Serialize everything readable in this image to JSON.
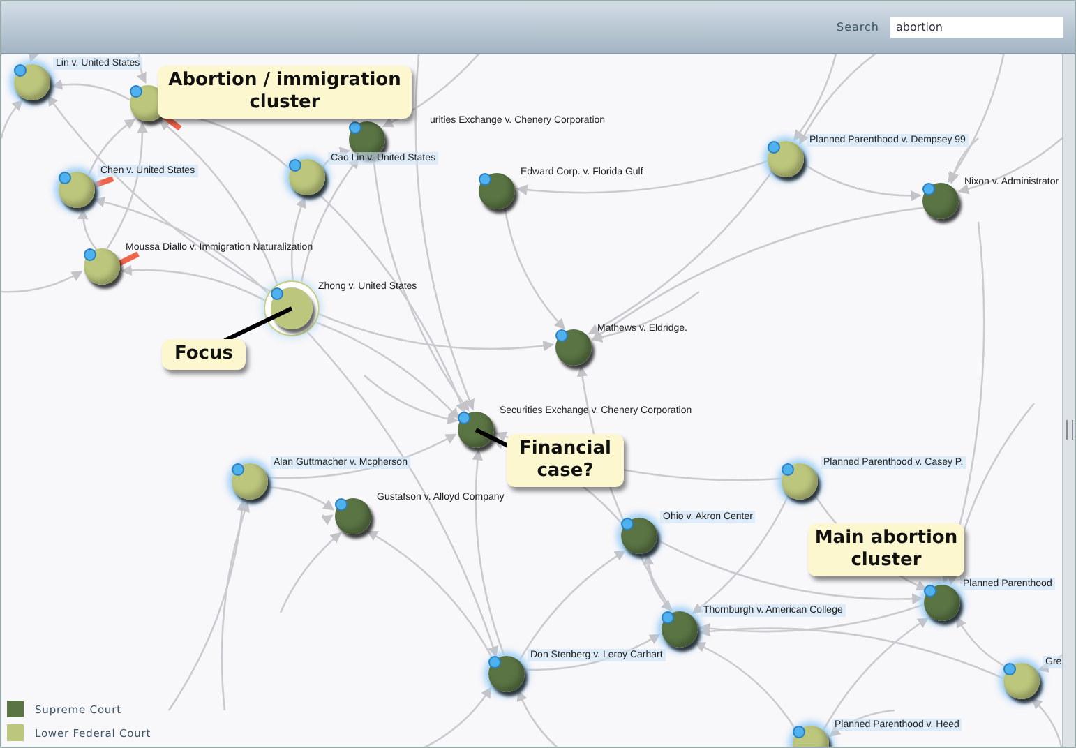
{
  "search": {
    "label": "Search",
    "value": "abortion"
  },
  "nodes": [
    {
      "label": "Lin v. United States",
      "kind": "lower",
      "highlighted": true,
      "selected": false
    },
    {
      "kind": "lower",
      "highlighted": false,
      "selected": false
    },
    {
      "label": "urities Exchange v. Chenery Corporation",
      "kind": "supreme",
      "highlighted": false,
      "selected": false
    },
    {
      "label": "Chen v. United States",
      "kind": "lower",
      "highlighted": true,
      "selected": false
    },
    {
      "label": "Cao Lin v. United States",
      "kind": "lower",
      "highlighted": true,
      "selected": false
    },
    {
      "label": "Edward Corp. v. Florida Gulf",
      "kind": "supreme",
      "highlighted": false,
      "selected": false
    },
    {
      "label": "Moussa Diallo v. Immigration Naturalization",
      "kind": "lower",
      "highlighted": false,
      "selected": false
    },
    {
      "label": "Zhong v. United States",
      "kind": "lower",
      "highlighted": false,
      "selected": true
    },
    {
      "label": "Planned Parenthood v. Dempsey 99",
      "kind": "lower",
      "highlighted": true,
      "selected": false
    },
    {
      "label": "Nixon v. Administrator",
      "kind": "supreme",
      "highlighted": false,
      "selected": false
    },
    {
      "label": "Mathews v. Eldridge.",
      "kind": "supreme",
      "highlighted": false,
      "selected": false
    },
    {
      "label": "Securities Exchange v. Chenery Corporation",
      "kind": "supreme",
      "highlighted": false,
      "selected": false
    },
    {
      "label": "Alan Guttmacher v. Mcpherson",
      "kind": "lower",
      "highlighted": true,
      "selected": false
    },
    {
      "label": "Gustafson v. Alloyd Company",
      "kind": "supreme",
      "highlighted": false,
      "selected": false
    },
    {
      "label": "Planned Parenthood v. Casey P.",
      "kind": "lower",
      "highlighted": true,
      "selected": false
    },
    {
      "label": "Ohio v. Akron Center",
      "kind": "supreme",
      "highlighted": true,
      "selected": false
    },
    {
      "label": "Thornburgh v. American College",
      "kind": "supreme",
      "highlighted": true,
      "selected": false
    },
    {
      "label": "Don Stenberg v. Leroy Carhart",
      "kind": "supreme",
      "highlighted": true,
      "selected": false
    },
    {
      "label": "Planned Parenthood",
      "kind": "supreme",
      "highlighted": true,
      "selected": false
    },
    {
      "label": "Gre",
      "kind": "lower",
      "highlighted": true,
      "selected": false
    },
    {
      "label": "Planned Parenthood v. Heed",
      "kind": "lower",
      "highlighted": true,
      "selected": false
    }
  ],
  "callouts": [
    {
      "text": "Abortion / immigration cluster"
    },
    {
      "text": "Focus"
    },
    {
      "text": "Financial case?"
    },
    {
      "text": "Main abortion cluster"
    }
  ],
  "legend": [
    {
      "label": "Supreme Court",
      "color": "#5a7444"
    },
    {
      "label": "Lower Federal Court",
      "color": "#bcc67c"
    }
  ]
}
